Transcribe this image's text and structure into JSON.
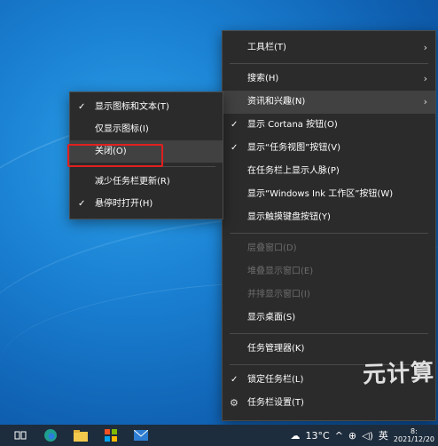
{
  "main_menu": {
    "items": [
      {
        "label": "工具栏(T)",
        "arrow": "›",
        "check": "",
        "disabled": false
      },
      {
        "label": "搜索(H)",
        "arrow": "›",
        "check": "",
        "disabled": false
      },
      {
        "label": "资讯和兴趣(N)",
        "arrow": "›",
        "check": "",
        "disabled": false
      },
      {
        "label": "显示 Cortana 按钮(O)",
        "check": "✓",
        "disabled": false
      },
      {
        "label": "显示“任务视图”按钮(V)",
        "check": "✓",
        "disabled": false
      },
      {
        "label": "在任务栏上显示人脉(P)",
        "check": "",
        "disabled": false
      },
      {
        "label": "显示“Windows Ink 工作区”按钮(W)",
        "check": "",
        "disabled": false
      },
      {
        "label": "显示触摸键盘按钮(Y)",
        "check": "",
        "disabled": false
      },
      {
        "label": "层叠窗口(D)",
        "check": "",
        "disabled": true
      },
      {
        "label": "堆叠显示窗口(E)",
        "check": "",
        "disabled": true
      },
      {
        "label": "并排显示窗口(I)",
        "check": "",
        "disabled": true
      },
      {
        "label": "显示桌面(S)",
        "check": "",
        "disabled": false
      },
      {
        "label": "任务管理器(K)",
        "check": "",
        "disabled": false
      },
      {
        "label": "锁定任务栏(L)",
        "check": "✓",
        "disabled": false
      },
      {
        "label": "任务栏设置(T)",
        "check": "",
        "disabled": false
      }
    ]
  },
  "sub_menu": {
    "items": [
      {
        "label": "显示图标和文本(T)",
        "check": "✓"
      },
      {
        "label": "仅显示图标(I)",
        "check": ""
      },
      {
        "label": "关闭(O)",
        "check": ""
      },
      {
        "label": "减少任务栏更新(R)",
        "check": ""
      },
      {
        "label": "悬停时打开(H)",
        "check": "✓"
      }
    ]
  },
  "taskbar": {
    "weather_temp": "13°C",
    "ime_label": "英",
    "clock_time": "8:",
    "clock_date": "2021/12/20"
  },
  "icons": {
    "gear": "⚙",
    "checkmark": "✓",
    "chevron": "›"
  },
  "watermark": "元计算"
}
